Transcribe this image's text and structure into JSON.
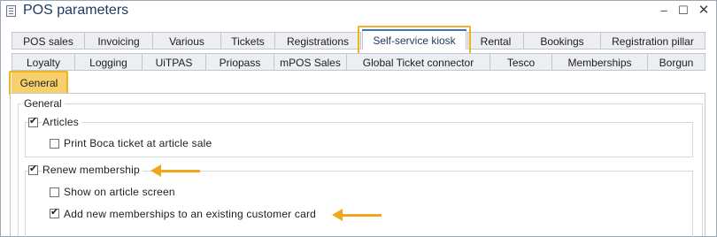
{
  "window": {
    "title": "POS parameters",
    "minimize_glyph": "–",
    "maximize_glyph": "☐",
    "close_glyph": "✕"
  },
  "tabs": {
    "row1": [
      "POS sales",
      "Invoicing",
      "Various",
      "Tickets",
      "Registrations",
      "Self-service kiosk",
      "Rental",
      "Bookings",
      "Registration pillar"
    ],
    "row2": [
      "Loyalty",
      "Logging",
      "UiTPAS",
      "Priopass",
      "mPOS Sales",
      "Global Ticket connector",
      "Tesco",
      "Memberships",
      "Borgun"
    ],
    "selected": "Self-service kiosk"
  },
  "subtab": {
    "label": "General"
  },
  "general": {
    "legend": "General",
    "articles": {
      "label": "Articles",
      "checked": true,
      "print_boca": {
        "label": "Print Boca ticket at article sale",
        "checked": false
      }
    },
    "renew_membership": {
      "label": "Renew membership",
      "checked": true,
      "show_on_article_screen": {
        "label": "Show on article screen",
        "checked": false
      },
      "add_new_memberships": {
        "label": "Add new memberships to an existing customer card",
        "checked": true
      }
    }
  },
  "colors": {
    "highlight": "#f0b323",
    "subtab_fill": "#f7cf6b",
    "arrow": "#f0a61d",
    "selected_tab_accent": "#3f78b9",
    "title": "#1f3b63"
  }
}
